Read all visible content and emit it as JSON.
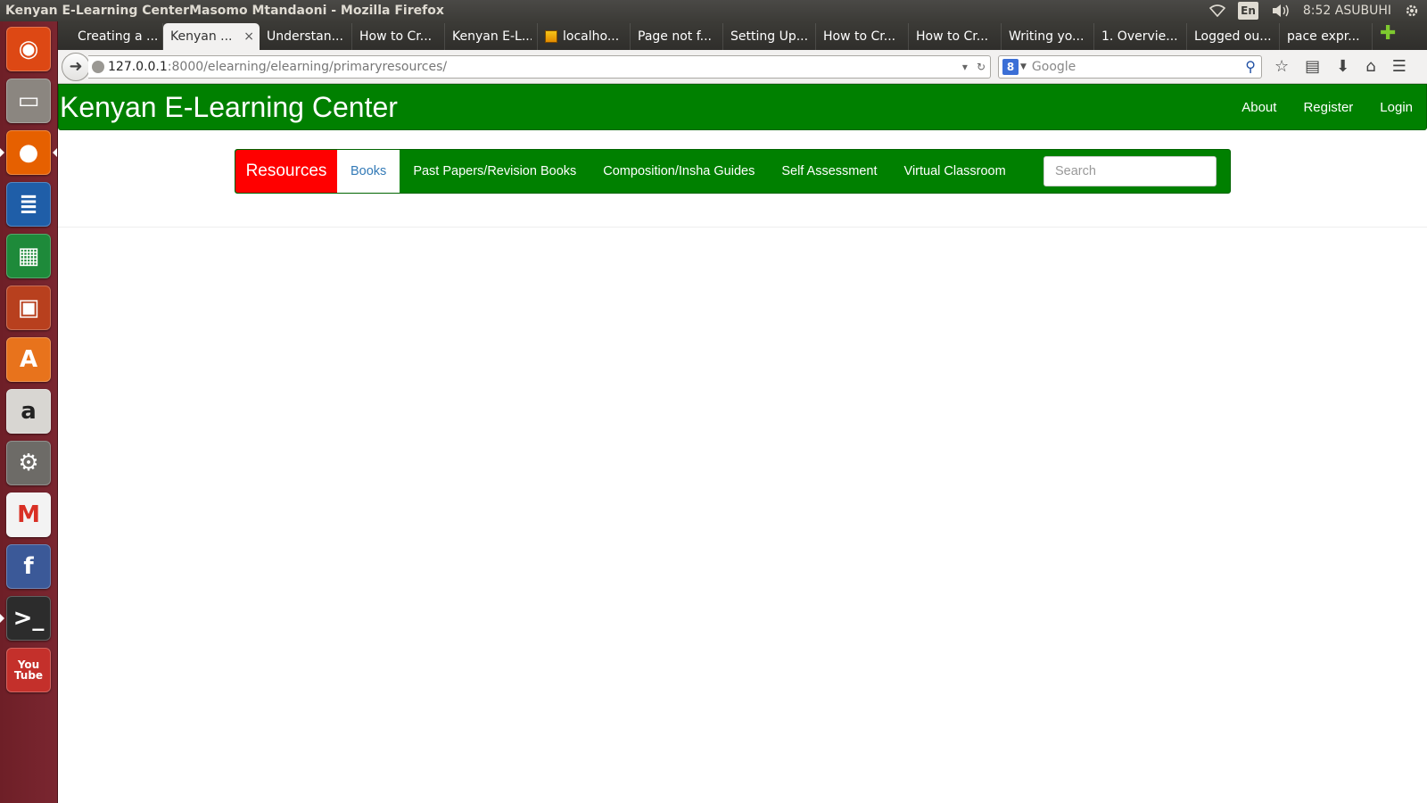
{
  "os": {
    "window_title": "Kenyan E-Learning CenterMasomo Mtandaoni - Mozilla Firefox",
    "keyboard_lang": "En",
    "clock": "8:52 ASUBUHI"
  },
  "launcher": [
    {
      "name": "ubuntu-dash",
      "glyph": "◉",
      "bg": "#dd4814"
    },
    {
      "name": "files",
      "glyph": "▭",
      "bg": "#8b8680"
    },
    {
      "name": "firefox",
      "glyph": "●",
      "bg": "#e66000"
    },
    {
      "name": "libreoffice-writer",
      "glyph": "≣",
      "bg": "#1f5ea8"
    },
    {
      "name": "libreoffice-calc",
      "glyph": "▦",
      "bg": "#1e8a3a"
    },
    {
      "name": "libreoffice-impress",
      "glyph": "▣",
      "bg": "#b8401e"
    },
    {
      "name": "software-center",
      "glyph": "A",
      "bg": "#e8731c"
    },
    {
      "name": "amazon",
      "glyph": "a",
      "bg": "#d8d6d2"
    },
    {
      "name": "system-settings",
      "glyph": "⚙",
      "bg": "#6d6b67"
    },
    {
      "name": "gmail",
      "glyph": "M",
      "bg": "#f3f3f3"
    },
    {
      "name": "facebook",
      "glyph": "f",
      "bg": "#3b5998"
    },
    {
      "name": "terminal",
      "glyph": ">_",
      "bg": "#2c2c2c"
    },
    {
      "name": "youtube",
      "glyph": "You Tube",
      "bg": "#c4302b"
    }
  ],
  "tabs": [
    {
      "label": "Creating a ...",
      "active": false
    },
    {
      "label": "Kenyan ...",
      "active": true
    },
    {
      "label": "Understan...",
      "active": false
    },
    {
      "label": "How to Cr...",
      "active": false
    },
    {
      "label": "Kenyan E-L...",
      "active": false
    },
    {
      "label": "localho...",
      "active": false,
      "favicon": true
    },
    {
      "label": "Page not f...",
      "active": false
    },
    {
      "label": "Setting Up...",
      "active": false
    },
    {
      "label": "How to Cr...",
      "active": false
    },
    {
      "label": "How to Cr...",
      "active": false
    },
    {
      "label": "Writing yo...",
      "active": false
    },
    {
      "label": "1. Overvie...",
      "active": false
    },
    {
      "label": "Logged ou...",
      "active": false
    },
    {
      "label": "pace expr...",
      "active": false
    }
  ],
  "browser": {
    "url_host": "127.0.0.1",
    "url_path": ":8000/elearning/elearning/primaryresources/",
    "search_placeholder": "Google",
    "close_glyph": "×",
    "newtab_glyph": "✚"
  },
  "site": {
    "brand": "Kenyan E-Learning Center",
    "header_links": [
      "About",
      "Register",
      "Login"
    ],
    "subnav": {
      "resources_label": "Resources",
      "links": [
        {
          "label": "Books",
          "active": true
        },
        {
          "label": "Past Papers/Revision Books",
          "active": false
        },
        {
          "label": "Composition/Insha Guides",
          "active": false
        },
        {
          "label": "Self Assessment",
          "active": false
        },
        {
          "label": "Virtual Classroom",
          "active": false
        }
      ],
      "search_placeholder": "Search"
    }
  },
  "colors": {
    "site_green": "#008000",
    "resources_red": "#ff0000",
    "active_link_blue": "#337ab7"
  }
}
